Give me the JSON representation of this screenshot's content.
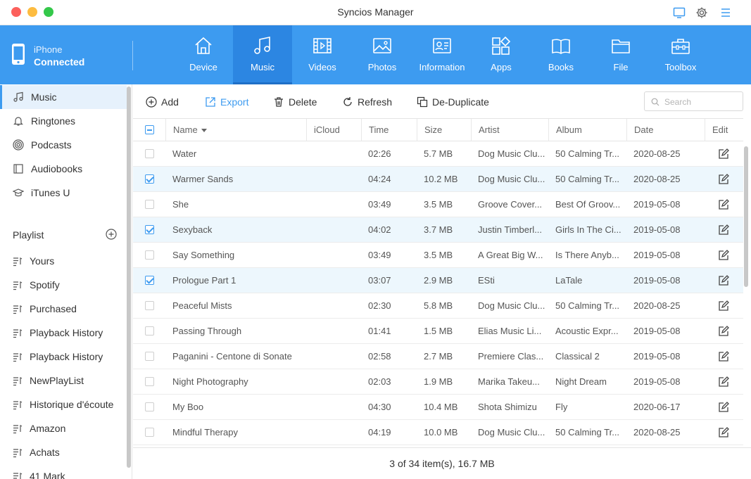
{
  "window": {
    "title": "Syncios Manager"
  },
  "device": {
    "name": "iPhone",
    "status": "Connected"
  },
  "nav": [
    {
      "label": "Device",
      "icon": "home-icon",
      "active": false
    },
    {
      "label": "Music",
      "icon": "music-note-icon",
      "active": true
    },
    {
      "label": "Videos",
      "icon": "film-icon",
      "active": false
    },
    {
      "label": "Photos",
      "icon": "image-icon",
      "active": false
    },
    {
      "label": "Information",
      "icon": "contact-card-icon",
      "active": false
    },
    {
      "label": "Apps",
      "icon": "apps-grid-icon",
      "active": false
    },
    {
      "label": "Books",
      "icon": "book-icon",
      "active": false
    },
    {
      "label": "File",
      "icon": "folder-icon",
      "active": false
    },
    {
      "label": "Toolbox",
      "icon": "toolbox-icon",
      "active": false
    }
  ],
  "sidebar": {
    "items": [
      {
        "label": "Music",
        "icon": "music-note-icon",
        "active": true
      },
      {
        "label": "Ringtones",
        "icon": "bell-icon",
        "active": false
      },
      {
        "label": "Podcasts",
        "icon": "podcast-icon",
        "active": false
      },
      {
        "label": "Audiobooks",
        "icon": "audiobook-icon",
        "active": false
      },
      {
        "label": "iTunes U",
        "icon": "graduation-cap-icon",
        "active": false
      }
    ],
    "playlist_header": "Playlist",
    "playlists": [
      "Yours",
      "Spotify",
      "Purchased",
      "Playback History",
      "Playback History",
      "NewPlayList",
      "Historique d'écoute",
      "Amazon",
      "Achats",
      "41 Mark"
    ]
  },
  "toolbar": {
    "add": "Add",
    "export": "Export",
    "delete": "Delete",
    "refresh": "Refresh",
    "dedupe": "De-Duplicate",
    "search_placeholder": "Search"
  },
  "table": {
    "headers": {
      "name": "Name",
      "icloud": "iCloud",
      "time": "Time",
      "size": "Size",
      "artist": "Artist",
      "album": "Album",
      "date": "Date",
      "edit": "Edit"
    },
    "rows": [
      {
        "checked": false,
        "name": "Water",
        "icloud": "",
        "time": "02:26",
        "size": "5.7 MB",
        "artist": "Dog Music Clu...",
        "album": "50 Calming Tr...",
        "date": "2020-08-25"
      },
      {
        "checked": true,
        "name": "Warmer Sands",
        "icloud": "",
        "time": "04:24",
        "size": "10.2 MB",
        "artist": "Dog Music Clu...",
        "album": "50 Calming Tr...",
        "date": "2020-08-25"
      },
      {
        "checked": false,
        "name": "She",
        "icloud": "",
        "time": "03:49",
        "size": "3.5 MB",
        "artist": "Groove Cover...",
        "album": "Best Of Groov...",
        "date": "2019-05-08"
      },
      {
        "checked": true,
        "name": "Sexyback",
        "icloud": "",
        "time": "04:02",
        "size": "3.7 MB",
        "artist": "Justin Timberl...",
        "album": "Girls In The Ci...",
        "date": "2019-05-08"
      },
      {
        "checked": false,
        "name": "Say Something",
        "icloud": "",
        "time": "03:49",
        "size": "3.5 MB",
        "artist": "A Great Big W...",
        "album": "Is There Anyb...",
        "date": "2019-05-08"
      },
      {
        "checked": true,
        "name": "Prologue Part 1",
        "icloud": "",
        "time": "03:07",
        "size": "2.9 MB",
        "artist": "ESti",
        "album": "LaTale",
        "date": "2019-05-08"
      },
      {
        "checked": false,
        "name": "Peaceful Mists",
        "icloud": "",
        "time": "02:30",
        "size": "5.8 MB",
        "artist": "Dog Music Clu...",
        "album": "50 Calming Tr...",
        "date": "2020-08-25"
      },
      {
        "checked": false,
        "name": "Passing Through",
        "icloud": "",
        "time": "01:41",
        "size": "1.5 MB",
        "artist": "Elias Music Li...",
        "album": "Acoustic Expr...",
        "date": "2019-05-08"
      },
      {
        "checked": false,
        "name": "Paganini - Centone di Sonate",
        "icloud": "",
        "time": "02:58",
        "size": "2.7 MB",
        "artist": "Premiere Clas...",
        "album": "Classical 2",
        "date": "2019-05-08"
      },
      {
        "checked": false,
        "name": "Night Photography",
        "icloud": "",
        "time": "02:03",
        "size": "1.9 MB",
        "artist": "Marika Takeu...",
        "album": "Night Dream",
        "date": "2019-05-08"
      },
      {
        "checked": false,
        "name": "My Boo",
        "icloud": "",
        "time": "04:30",
        "size": "10.4 MB",
        "artist": "Shota Shimizu",
        "album": "Fly",
        "date": "2020-06-17"
      },
      {
        "checked": false,
        "name": "Mindful Therapy",
        "icloud": "",
        "time": "04:19",
        "size": "10.0 MB",
        "artist": "Dog Music Clu...",
        "album": "50 Calming Tr...",
        "date": "2020-08-25"
      }
    ]
  },
  "status": "3 of 34 item(s), 16.7 MB",
  "colors": {
    "accent": "#3d9bf0",
    "nav_active": "#2c86e2",
    "row_selected": "#edf7fd"
  }
}
